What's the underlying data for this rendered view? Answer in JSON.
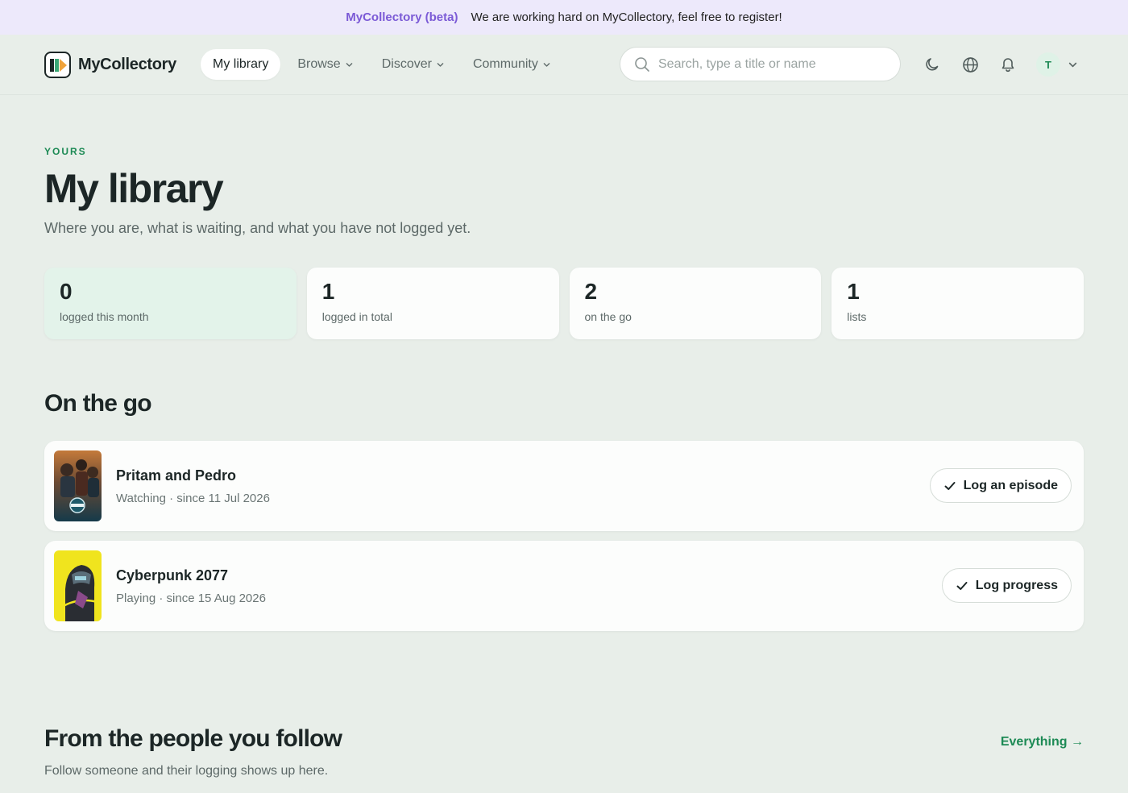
{
  "banner": {
    "brand": "MyCollectory (beta)",
    "message": "We are working hard on MyCollectory, feel free to register!"
  },
  "nav": {
    "logo_text": "MyCollectory",
    "links": [
      {
        "label": "My library",
        "active": true
      },
      {
        "label": "Browse",
        "dropdown": true
      },
      {
        "label": "Discover",
        "dropdown": true
      },
      {
        "label": "Community",
        "dropdown": true
      }
    ],
    "search_placeholder": "Search, type a title or name",
    "icons": [
      "moon-icon",
      "globe-icon",
      "bell-icon"
    ],
    "avatar_initial": "T"
  },
  "header": {
    "eyebrow": "YOURS",
    "title": "My library",
    "subtitle": "Where you are, what is waiting, and what you have not logged yet."
  },
  "stats": [
    {
      "value": "0",
      "label": "logged this month"
    },
    {
      "value": "1",
      "label": "logged in total"
    },
    {
      "value": "2",
      "label": "on the go"
    },
    {
      "value": "1",
      "label": "lists"
    }
  ],
  "on_the_go": {
    "title": "On the go",
    "items": [
      {
        "title": "Pritam and Pedro",
        "meta": "Watching · since 11 Jul 2026",
        "action": "Log an episode"
      },
      {
        "title": "Cyberpunk 2077",
        "meta": "Playing · since 15 Aug 2026",
        "action": "Log progress"
      }
    ]
  },
  "following": {
    "title": "From the people you follow",
    "link": "Everything →",
    "subtitle": "Follow someone and their logging shows up here."
  },
  "colors": {
    "accent": "#1d8a55",
    "brand_purple": "#7b5ad6",
    "background": "#e8eee9"
  }
}
